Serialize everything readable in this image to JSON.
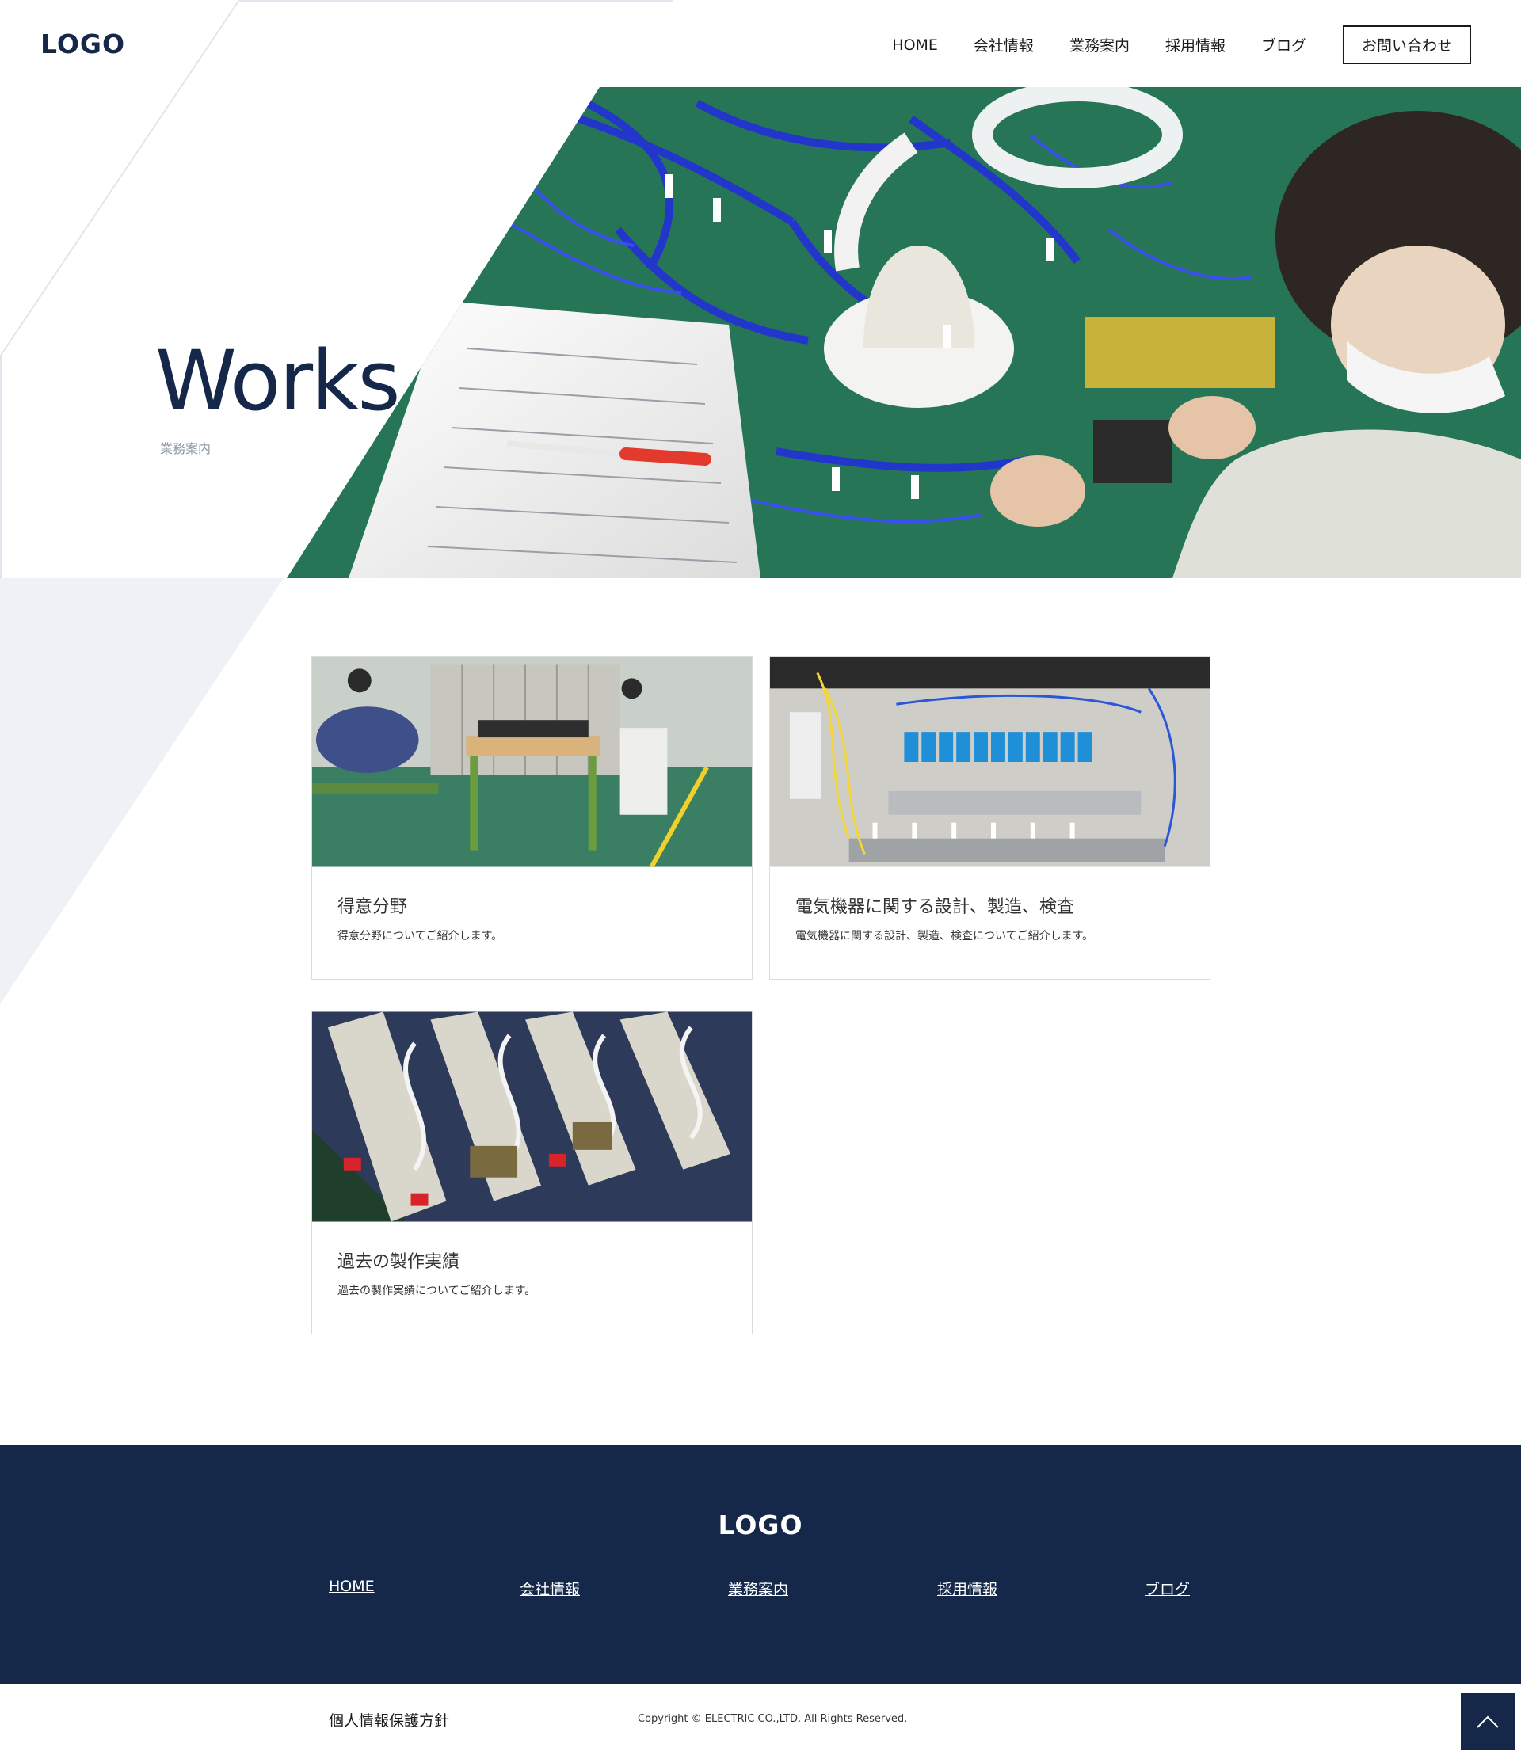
{
  "header": {
    "logo": "LOGO",
    "nav": [
      "HOME",
      "会社情報",
      "業務案内",
      "採用情報",
      "ブログ"
    ],
    "contact_label": "お問い合わせ"
  },
  "hero": {
    "title": "Works",
    "subtitle": "業務案内"
  },
  "cards": [
    {
      "title": "得意分野",
      "desc": "得意分野についてご紹介します。"
    },
    {
      "title": "電気機器に関する設計、製造、検査",
      "desc": "電気機器に関する設計、製造、検査についてご紹介します。"
    },
    {
      "title": "過去の製作実績",
      "desc": "過去の製作実績についてご紹介します。"
    }
  ],
  "footer": {
    "logo": "LOGO",
    "nav": [
      "HOME",
      "会社情報",
      "業務案内",
      "採用情報",
      "ブログ"
    ],
    "privacy": "個人情報保護方針",
    "copyright": "Copyright © ELECTRIC CO.,LTD. All Rights Reserved."
  },
  "colors": {
    "brand_navy": "#15284a",
    "deco_light": "#eef2f7"
  },
  "icons": {
    "to_top": "chevron-up-icon"
  }
}
